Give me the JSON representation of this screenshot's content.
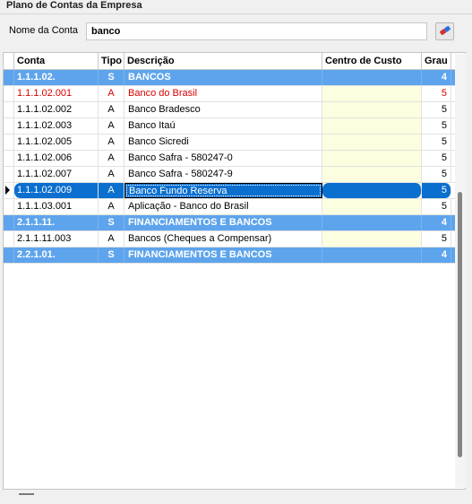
{
  "panel": {
    "title": "Plano de Contas da Empresa"
  },
  "search": {
    "label": "Nome da Conta",
    "value": "banco",
    "clear_icon": "eraser-icon"
  },
  "grid": {
    "columns": [
      "Conta",
      "Tipo",
      "Descrição",
      "Centro de Custo",
      "Grau"
    ],
    "rows": [
      {
        "conta": "1.1.1.02.",
        "tipo": "S",
        "descricao": "BANCOS",
        "centro": "",
        "grau": "4"
      },
      {
        "conta": "1.1.1.02.001",
        "tipo": "A",
        "descricao": "Banco do Brasil",
        "centro": "",
        "grau": "5"
      },
      {
        "conta": "1.1.1.02.002",
        "tipo": "A",
        "descricao": "Banco Bradesco",
        "centro": "",
        "grau": "5"
      },
      {
        "conta": "1.1.1.02.003",
        "tipo": "A",
        "descricao": "Banco Itaú",
        "centro": "",
        "grau": "5"
      },
      {
        "conta": "1.1.1.02.005",
        "tipo": "A",
        "descricao": "Banco Sicredi",
        "centro": "",
        "grau": "5"
      },
      {
        "conta": "1.1.1.02.006",
        "tipo": "A",
        "descricao": "Banco Safra - 580247-0",
        "centro": "",
        "grau": "5"
      },
      {
        "conta": "1.1.1.02.007",
        "tipo": "A",
        "descricao": "Banco Safra - 580247-9",
        "centro": "",
        "grau": "5"
      },
      {
        "conta": "1.1.1.02.009",
        "tipo": "A",
        "descricao": "Banco Fundo Reserva",
        "centro": "",
        "grau": "5"
      },
      {
        "conta": "1.1.1.03.001",
        "tipo": "A",
        "descricao": "Aplicação - Banco do Brasil",
        "centro": "",
        "grau": "5"
      },
      {
        "conta": "2.1.1.11.",
        "tipo": "S",
        "descricao": "FINANCIAMENTOS E BANCOS",
        "centro": "",
        "grau": "4"
      },
      {
        "conta": "2.1.1.11.003",
        "tipo": "A",
        "descricao": "Bancos (Cheques a Compensar)",
        "centro": "",
        "grau": "5"
      },
      {
        "conta": "2.2.1.01.",
        "tipo": "S",
        "descricao": "FINANCIAMENTOS E BANCOS",
        "centro": "",
        "grau": "4"
      }
    ],
    "selected_row": 7,
    "highlight_row": 1
  },
  "colors": {
    "synthetic_row": "#5ea4ec",
    "selected_row": "#0a6fcf",
    "cost_center_cell": "#fdfde0",
    "highlight_text": "#d80000"
  }
}
